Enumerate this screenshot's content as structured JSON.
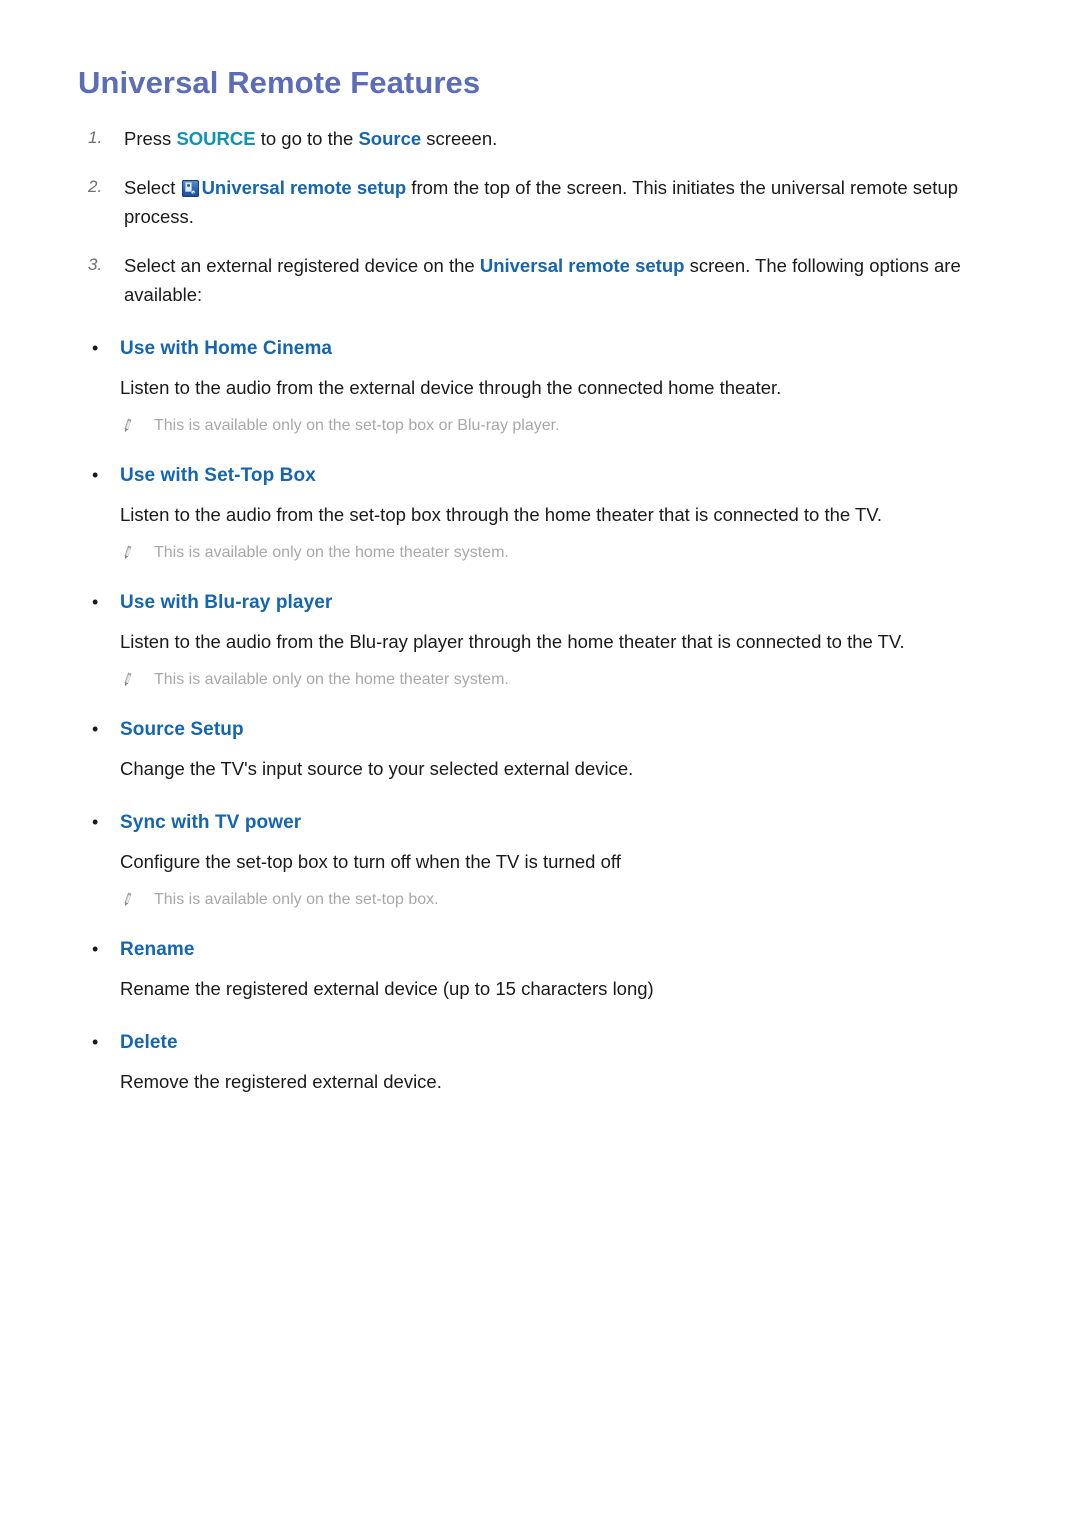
{
  "page": {
    "title": "Universal Remote Features"
  },
  "colors": {
    "title": "#5b6cb8",
    "link_blue": "#1565b0",
    "key_teal": "#0e93b5",
    "body": "#1a1a1a",
    "note_gray": "#a8a8a8",
    "step_number_gray": "#6f6f6f"
  },
  "steps": [
    {
      "number": "1.",
      "parts": [
        {
          "type": "text",
          "value": "Press "
        },
        {
          "type": "key",
          "value": "SOURCE"
        },
        {
          "type": "text",
          "value": "  to go to the "
        },
        {
          "type": "link",
          "value": "Source"
        },
        {
          "type": "text",
          "value": " screeen."
        }
      ]
    },
    {
      "number": "2.",
      "parts": [
        {
          "type": "text",
          "value": "Select "
        },
        {
          "type": "icon",
          "value": "universal-remote-setup-icon"
        },
        {
          "type": "link",
          "value": "Universal remote setup"
        },
        {
          "type": "text",
          "value": " from the top of the screen. This initiates the universal remote setup process."
        }
      ]
    },
    {
      "number": "3.",
      "parts": [
        {
          "type": "text",
          "value": "Select an external registered device on the "
        },
        {
          "type": "link",
          "value": "Universal remote setup"
        },
        {
          "type": "text",
          "value": " screen. The following options are available:"
        }
      ]
    }
  ],
  "options": [
    {
      "title": "Use with Home Cinema",
      "description": "Listen to the audio from the external device through the connected home theater.",
      "note": "This is available only on the set-top box or Blu-ray player."
    },
    {
      "title": "Use with Set-Top Box",
      "description": "Listen to the audio from the set-top box through the home theater that is connected to the TV.",
      "note": "This is available only on the home theater system."
    },
    {
      "title": "Use with Blu-ray player",
      "description": "Listen to the audio from the Blu-ray player through the home theater that is connected to the TV.",
      "note": "This is available only on the home theater system."
    },
    {
      "title": "Source Setup",
      "description": "Change the TV's input source to your selected external device.",
      "note": null
    },
    {
      "title": "Sync with TV power",
      "description": "Configure the set-top box to turn off when the TV is turned off",
      "note": "This is available only on the set-top box."
    },
    {
      "title": "Rename",
      "description": "Rename the registered external device (up to 15 characters long)",
      "note": null
    },
    {
      "title": "Delete",
      "description": "Remove the registered external device.",
      "note": null
    }
  ]
}
